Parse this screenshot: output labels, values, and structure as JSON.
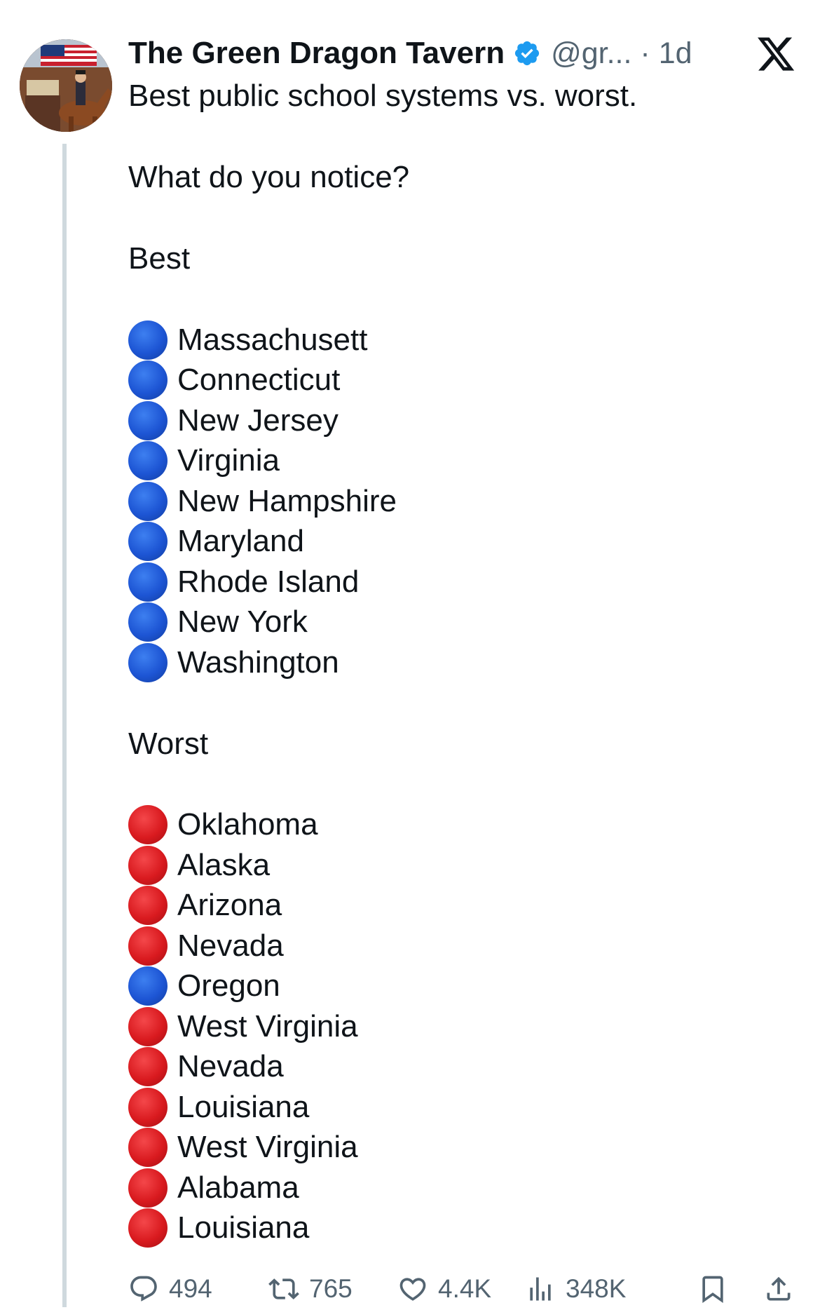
{
  "post": {
    "author_name": "The Green Dragon Tavern",
    "handle": "@gr...",
    "separator": "·",
    "time": "1d",
    "text_lines": [
      "Best public school systems vs. worst.",
      "What do you notice?"
    ]
  },
  "best": {
    "heading": "Best",
    "items": [
      {
        "label": "Massachusett",
        "dot": "blue"
      },
      {
        "label": "Connecticut",
        "dot": "blue"
      },
      {
        "label": "New Jersey",
        "dot": "blue"
      },
      {
        "label": "Virginia",
        "dot": "blue"
      },
      {
        "label": "New Hampshire",
        "dot": "blue"
      },
      {
        "label": "Maryland",
        "dot": "blue"
      },
      {
        "label": "Rhode Island",
        "dot": "blue"
      },
      {
        "label": "New York",
        "dot": "blue"
      },
      {
        "label": "Washington",
        "dot": "blue"
      }
    ]
  },
  "worst": {
    "heading": "Worst",
    "items": [
      {
        "label": "Oklahoma",
        "dot": "red"
      },
      {
        "label": "Alaska",
        "dot": "red"
      },
      {
        "label": "Arizona",
        "dot": "red"
      },
      {
        "label": "Nevada",
        "dot": "red"
      },
      {
        "label": "Oregon",
        "dot": "blue"
      },
      {
        "label": "West Virginia",
        "dot": "red"
      },
      {
        "label": "Nevada",
        "dot": "red"
      },
      {
        "label": "Louisiana",
        "dot": "red"
      },
      {
        "label": "West Virginia",
        "dot": "red"
      },
      {
        "label": "Alabama",
        "dot": "red"
      },
      {
        "label": "Louisiana",
        "dot": "red"
      }
    ]
  },
  "actions": {
    "replies": "494",
    "reposts": "765",
    "likes": "4.4K",
    "views": "348K"
  },
  "icons": {
    "verified": "verified-badge-icon",
    "logo": "x-logo-icon",
    "reply": "reply-icon",
    "repost": "repost-icon",
    "like": "heart-icon",
    "views": "views-chart-icon",
    "bookmark": "bookmark-icon",
    "share": "share-icon"
  },
  "colors": {
    "text": "#0f1419",
    "muted": "#536471",
    "verified": "#1d9bf0",
    "blue_dot": "#1d55d4",
    "red_dot": "#d91a1f",
    "thread_line": "#cfd9de"
  }
}
